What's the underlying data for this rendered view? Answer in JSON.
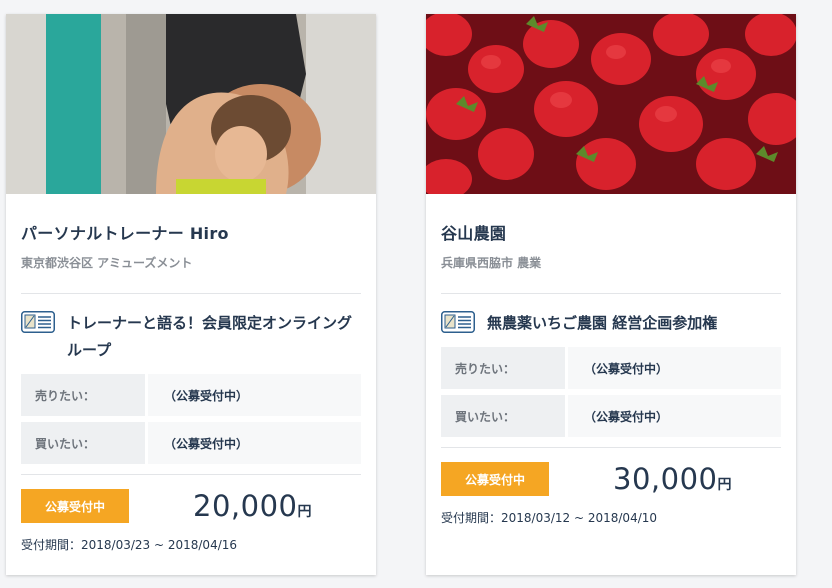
{
  "cards": [
    {
      "title": "パーソナルトレーナー Hiro",
      "subtitle": "東京都渋谷区 アミューズメント",
      "offer": "トレーナーと語る！会員限定オンライングループ",
      "rows": [
        {
          "label": "売りたい：",
          "value": "（公募受付中）"
        },
        {
          "label": "買いたい：",
          "value": "（公募受付中）"
        }
      ],
      "badge": "公募受付中",
      "price": "20,000",
      "unit": "円",
      "period": "受付期間：2018/03/23 ~ 2018/04/16"
    },
    {
      "title": "谷山農園",
      "subtitle": "兵庫県西脇市 農業",
      "offer": "無農薬いちご農園 経営企画参加権",
      "rows": [
        {
          "label": "売りたい：",
          "value": "（公募受付中）"
        },
        {
          "label": "買いたい：",
          "value": "（公募受付中）"
        }
      ],
      "badge": "公募受付中",
      "price": "30,000",
      "unit": "円",
      "period": "受付期間：2018/03/12 ~ 2018/04/10"
    }
  ],
  "colors": {
    "accent": "#f5a623",
    "text": "#26384f",
    "icon": "#2d5f8e"
  }
}
